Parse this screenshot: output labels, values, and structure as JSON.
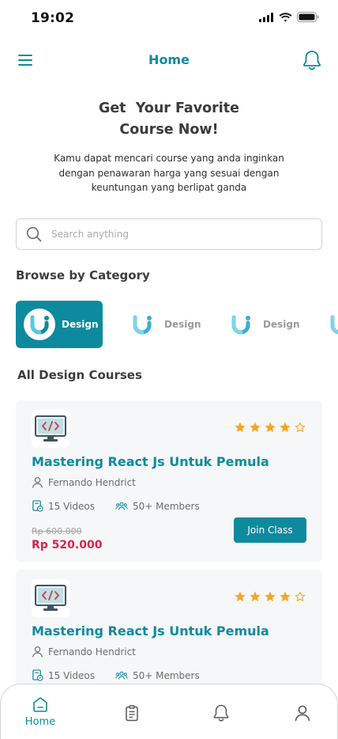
{
  "status_bar": {
    "time": "19:02"
  },
  "header": {
    "title": "Home"
  },
  "hero": {
    "title_line1": "Get  Your Favorite",
    "title_line2": "Course Now!",
    "description": "Kamu dapat mencari course yang anda inginkan dengan penawaran harga yang sesuai dengan keuntungan yang berlipat ganda"
  },
  "search": {
    "placeholder": "Search anything"
  },
  "categories_section": {
    "title": "Browse by Category",
    "items": [
      {
        "label": "Design",
        "active": true
      },
      {
        "label": "Design",
        "active": false
      },
      {
        "label": "Design",
        "active": false
      },
      {
        "label": "",
        "active": false
      }
    ]
  },
  "courses_section": {
    "title": "All Design Courses",
    "courses": [
      {
        "title": "Mastering React Js Untuk Pemula",
        "author": "Fernando Hendrict",
        "videos": "15 Videos",
        "members": "50+ Members",
        "old_price": "Rp 600.000",
        "price": "Rp 520.000",
        "rating": 4,
        "max_rating": 5,
        "cta": "Join Class",
        "thumb_icon": "code-monitor-icon"
      },
      {
        "title": "Mastering React Js Untuk Pemula",
        "author": "Fernando Hendrict",
        "videos": "15 Videos",
        "members": "50+ Members",
        "rating": 4,
        "max_rating": 5,
        "thumb_icon": "code-monitor-icon"
      }
    ]
  },
  "bottom_nav": {
    "items": [
      {
        "label": "Home",
        "icon": "home-icon",
        "active": true
      },
      {
        "label": "",
        "icon": "clipboard-icon",
        "active": false
      },
      {
        "label": "",
        "icon": "bell-icon",
        "active": false
      },
      {
        "label": "",
        "icon": "profile-icon",
        "active": false
      }
    ]
  },
  "colors": {
    "primary": "#0e8a9e",
    "price": "#d8234a",
    "star": "#f5a623",
    "card_bg": "#f6f7f8"
  }
}
